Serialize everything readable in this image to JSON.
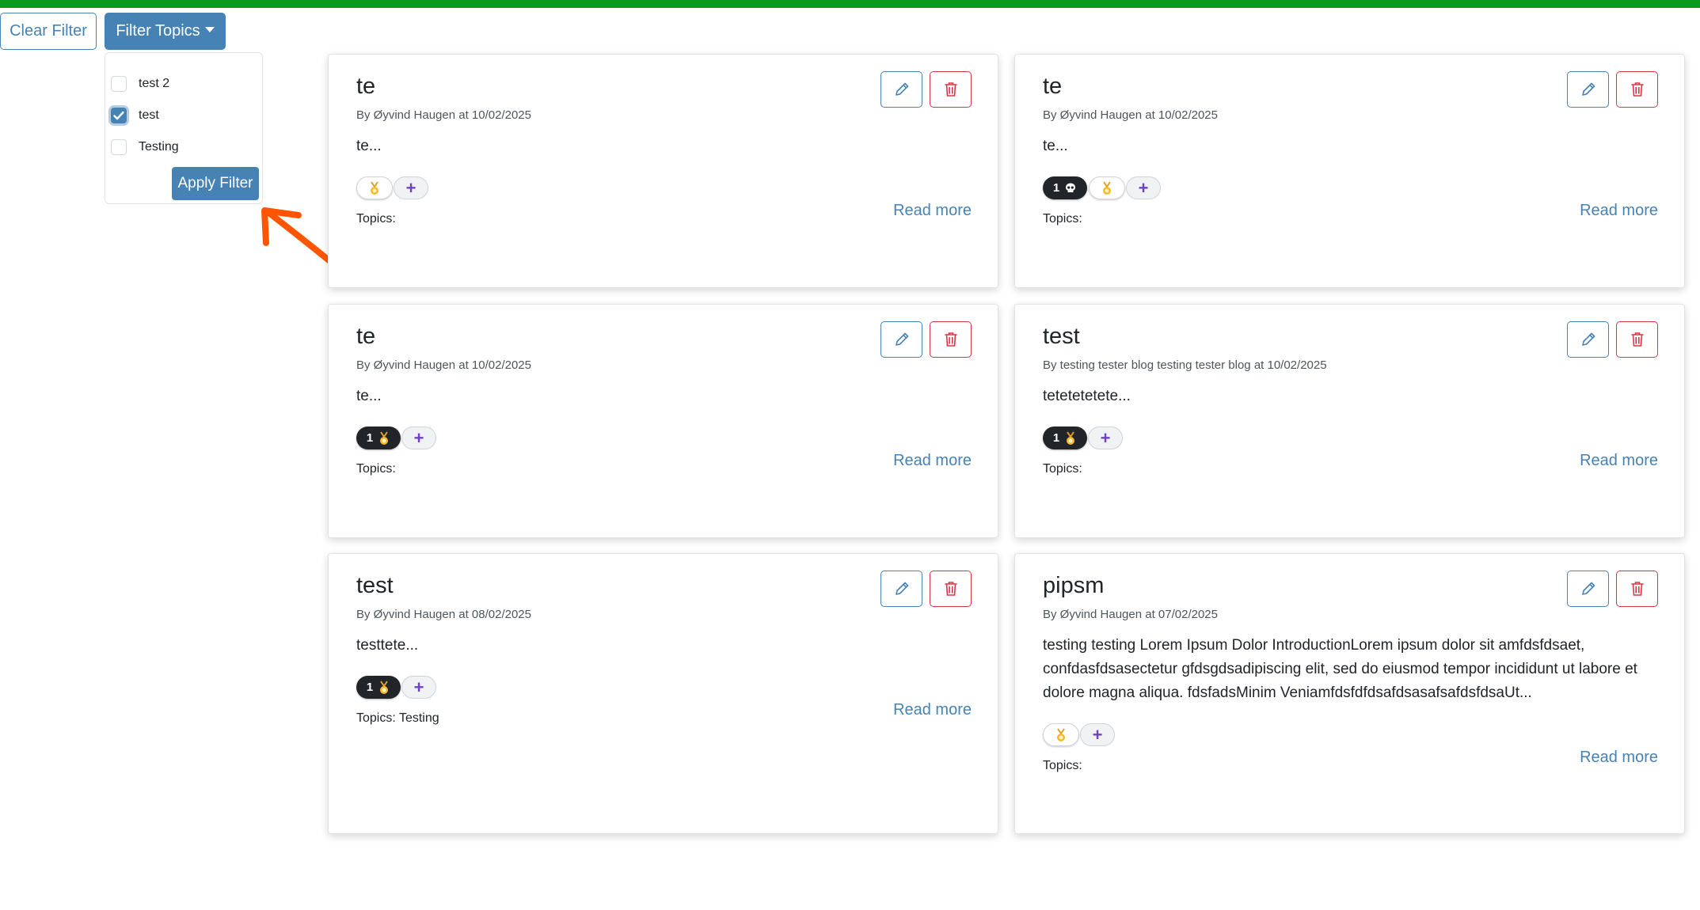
{
  "colors": {
    "top_bar": "#0a9a1e",
    "primary": "#4682b4",
    "danger": "#dc3545",
    "badge_dark": "#212529",
    "add_icon": "#6f42c1",
    "arrow": "#ff5500"
  },
  "toolbar": {
    "clear_filter_label": "Clear Filter",
    "filter_topics_label": "Filter Topics"
  },
  "filter_dropdown": {
    "options": [
      {
        "label": "test 2",
        "checked": false
      },
      {
        "label": "test",
        "checked": true
      },
      {
        "label": "Testing",
        "checked": false
      }
    ],
    "apply_label": "Apply Filter"
  },
  "posts": [
    {
      "title": "te",
      "meta": "By Øyvind Haugen at 10/02/2025",
      "excerpt": "te...",
      "reactions": [
        {
          "type": "react"
        }
      ],
      "topics": "Topics:",
      "read_more": "Read more"
    },
    {
      "title": "te",
      "meta": "By Øyvind Haugen at 10/02/2025",
      "excerpt": "te...",
      "reactions": [
        {
          "type": "count",
          "count": "1",
          "icon": "skull-icon"
        },
        {
          "type": "react"
        }
      ],
      "topics": "Topics:",
      "read_more": "Read more"
    },
    {
      "title": "te",
      "meta": "By Øyvind Haugen at 10/02/2025",
      "excerpt": "te...",
      "reactions": [
        {
          "type": "count",
          "count": "1",
          "icon": "gold-medal-icon"
        }
      ],
      "topics": "Topics:",
      "read_more": "Read more"
    },
    {
      "title": "test",
      "meta": "By testing tester blog testing tester blog at 10/02/2025",
      "excerpt": "tetetetetete...",
      "reactions": [
        {
          "type": "count",
          "count": "1",
          "icon": "gold-medal-icon"
        }
      ],
      "topics": "Topics:",
      "read_more": "Read more"
    },
    {
      "title": "test",
      "meta": "By Øyvind Haugen at 08/02/2025",
      "excerpt": "testtete...",
      "reactions": [
        {
          "type": "count",
          "count": "1",
          "icon": "gold-medal-icon"
        }
      ],
      "topics": "Topics: Testing",
      "read_more": "Read more"
    },
    {
      "title": "pipsm",
      "meta": "By Øyvind Haugen at 07/02/2025",
      "excerpt": "testing testing Lorem Ipsum Dolor IntroductionLorem ipsum dolor sit amfdsfdsaet, confdasfdsasectetur gfdsgdsadipiscing elit, sed do eiusmod tempor incididunt ut labore et dolore magna aliqua. fdsfadsMinim Veniamfdsfdfdsafdsasafsafdsfdsa​Ut...",
      "reactions": [
        {
          "type": "react"
        }
      ],
      "topics": "Topics:",
      "read_more": "Read more"
    }
  ]
}
